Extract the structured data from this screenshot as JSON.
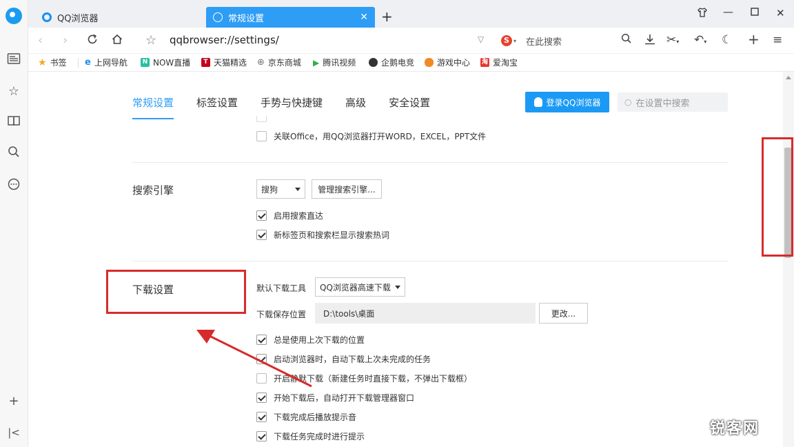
{
  "tabs": [
    {
      "title": "QQ浏览器"
    },
    {
      "title": "常规设置"
    }
  ],
  "address": {
    "url": "qqbrowser://settings/",
    "search_placeholder": "在此搜索",
    "search_engine_glyph": "S"
  },
  "bookmarks": [
    {
      "label": "书签",
      "icon": "star-icon",
      "color": "#f5a623"
    },
    {
      "label": "上网导航",
      "icon": "e-icon",
      "color": "#1a8ff0"
    },
    {
      "label": "NOW直播",
      "icon": "now-icon",
      "color": "#26c0a0"
    },
    {
      "label": "天猫精选",
      "icon": "tmall-icon",
      "color": "#c4001b"
    },
    {
      "label": "京东商城",
      "icon": "globe-icon",
      "color": "#777777"
    },
    {
      "label": "腾讯视频",
      "icon": "play-icon",
      "color": "#2bb24c"
    },
    {
      "label": "企鹅电竞",
      "icon": "penguin-icon",
      "color": "#333333"
    },
    {
      "label": "游戏中心",
      "icon": "gamepad-icon",
      "color": "#f08a24"
    },
    {
      "label": "爱淘宝",
      "icon": "taobao-icon",
      "color": "#e8352f"
    }
  ],
  "settings": {
    "tabs": [
      "常规设置",
      "标签设置",
      "手势与快捷键",
      "高级",
      "安全设置"
    ],
    "active_tab": "常规设置",
    "login_button": "登录QQ浏览器",
    "search_placeholder": "在设置中搜索",
    "office_option": "关联Office，用QQ浏览器打开WORD，EXCEL，PPT文件",
    "search_engine": {
      "title": "搜索引擎",
      "selected": "搜狗",
      "manage_button": "管理搜索引擎...",
      "options": [
        {
          "label": "启用搜索直达",
          "checked": true
        },
        {
          "label": "新标签页和搜索栏显示搜索热词",
          "checked": true
        }
      ]
    },
    "download": {
      "title": "下载设置",
      "default_tool_label": "默认下载工具",
      "default_tool_value": "QQ浏览器高速下载",
      "save_location_label": "下载保存位置",
      "save_location_value": "D:\\tools\\桌面",
      "change_button": "更改...",
      "options": [
        {
          "label": "总是使用上次下载的位置",
          "checked": true
        },
        {
          "label": "启动浏览器时，自动下载上次未完成的任务",
          "checked": true
        },
        {
          "label": "开启静默下载（新建任务时直接下载，不弹出下载框）",
          "checked": false
        },
        {
          "label": "开始下载后，自动打开下载管理器窗口",
          "checked": true
        },
        {
          "label": "下载完成后播放提示音",
          "checked": true
        },
        {
          "label": "下载任务完成时进行提示",
          "checked": true
        }
      ]
    }
  },
  "watermark": "锐客网",
  "colors": {
    "accent": "#2e9df5",
    "highlight": "#d62b2b"
  }
}
